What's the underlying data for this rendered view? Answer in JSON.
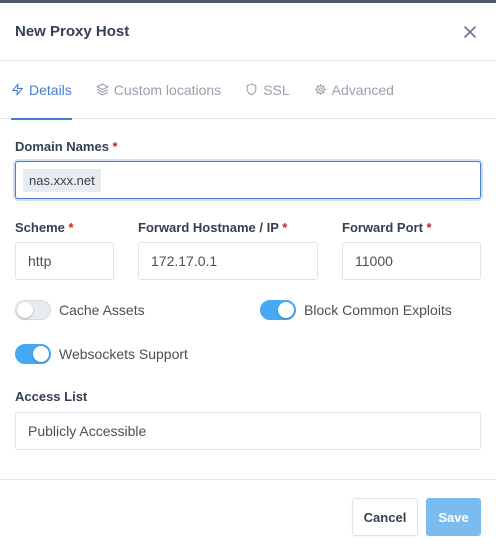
{
  "modal": {
    "title": "New Proxy Host"
  },
  "tabs": [
    {
      "label": "Details",
      "icon": "zap-icon",
      "active": true
    },
    {
      "label": "Custom locations",
      "icon": "layers-icon",
      "active": false
    },
    {
      "label": "SSL",
      "icon": "shield-icon",
      "active": false
    },
    {
      "label": "Advanced",
      "icon": "gear-icon",
      "active": false
    }
  ],
  "form": {
    "domain_names": {
      "label": "Domain Names",
      "required_mark": "*",
      "tags": [
        "nas.xxx.net"
      ]
    },
    "scheme": {
      "label": "Scheme",
      "required_mark": "*",
      "value": "http"
    },
    "forward_host": {
      "label": "Forward Hostname / IP",
      "required_mark": "*",
      "value": "172.17.0.1"
    },
    "forward_port": {
      "label": "Forward Port",
      "required_mark": "*",
      "value": "11000"
    },
    "toggles": {
      "cache_assets": {
        "label": "Cache Assets",
        "on": false
      },
      "block_exploits": {
        "label": "Block Common Exploits",
        "on": true
      },
      "websockets": {
        "label": "Websockets Support",
        "on": true
      }
    },
    "access_list": {
      "label": "Access List",
      "value": "Publicly Accessible"
    }
  },
  "footer": {
    "cancel_label": "Cancel",
    "save_label": "Save"
  },
  "colors": {
    "accent": "#467fcf",
    "toggle_on": "#45aaf2",
    "save_button": "#7bbcf0",
    "required": "#cd201f"
  }
}
